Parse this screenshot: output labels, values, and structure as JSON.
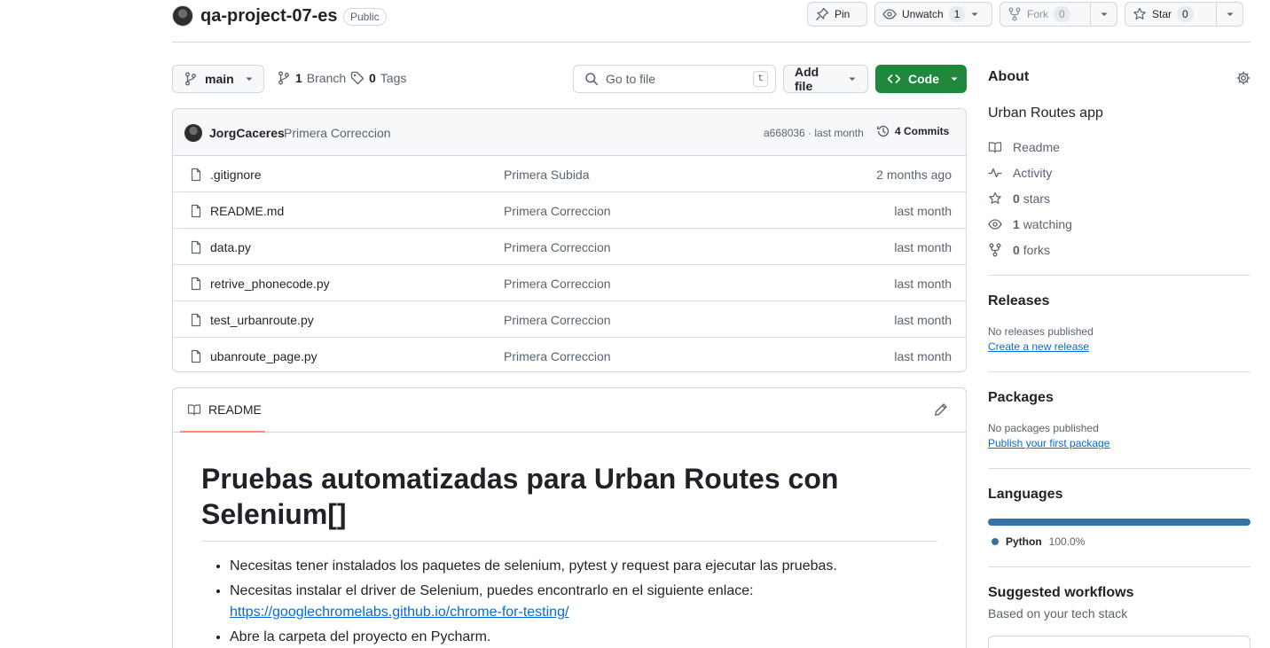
{
  "repo": {
    "name": "qa-project-07-es",
    "visibility": "Public",
    "pin_label": "Pin",
    "unwatch_label": "Unwatch",
    "watch_count": "1",
    "fork_label": "Fork",
    "fork_count": "0",
    "star_label": "Star",
    "star_count": "0"
  },
  "toolbar": {
    "branch": "main",
    "branch_count": "1",
    "branch_label": "Branch",
    "tag_count": "0",
    "tag_label": "Tags",
    "search_placeholder": "Go to file",
    "search_shortcut": "t",
    "add_file_label": "Add file",
    "code_label": "Code"
  },
  "latest_commit": {
    "author": "JorgCaceres",
    "message": "Primera Correccion",
    "sha_time": "a668036 · last month",
    "commits": "4 Commits"
  },
  "files": [
    {
      "name": ".gitignore",
      "message": "Primera Subida",
      "date": "2 months ago"
    },
    {
      "name": "README.md",
      "message": "Primera Correccion",
      "date": "last month"
    },
    {
      "name": "data.py",
      "message": "Primera Correccion",
      "date": "last month"
    },
    {
      "name": "retrive_phonecode.py",
      "message": "Primera Correccion",
      "date": "last month"
    },
    {
      "name": "test_urbanroute.py",
      "message": "Primera Correccion",
      "date": "last month"
    },
    {
      "name": "ubanroute_page.py",
      "message": "Primera Correccion",
      "date": "last month"
    }
  ],
  "readme": {
    "tab_label": "README",
    "heading": "Pruebas automatizadas para Urban Routes con Selenium[]",
    "bullets": [
      "Necesitas tener instalados los paquetes de selenium, pytest y request para ejecutar las pruebas.",
      "Necesitas instalar el driver de Selenium, puedes encontrarlo en el siguiente enlace:",
      "Abre la carpeta del proyecto en Pycharm."
    ],
    "link": "https://googlechromelabs.github.io/chrome-for-testing/"
  },
  "about": {
    "title": "About",
    "description": "Urban Routes app",
    "readme_label": "Readme",
    "activity_label": "Activity",
    "stars_count": "0",
    "stars_label": "stars",
    "watching_count": "1",
    "watching_label": "watching",
    "forks_count": "0",
    "forks_label": "forks"
  },
  "releases": {
    "title": "Releases",
    "empty": "No releases published",
    "link": "Create a new release"
  },
  "packages": {
    "title": "Packages",
    "empty": "No packages published",
    "link": "Publish your first package"
  },
  "languages": {
    "title": "Languages",
    "name": "Python",
    "percent": "100.0%",
    "color": "#3572a5"
  },
  "workflows": {
    "title": "Suggested workflows",
    "subtitle": "Based on your tech stack"
  },
  "colors": {
    "accent_green": "#1f883d",
    "link_blue": "#0969da",
    "tab_underline": "#fd8c73"
  }
}
